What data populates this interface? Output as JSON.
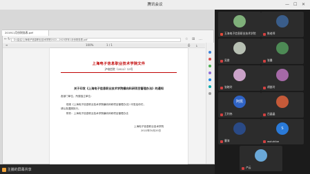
{
  "window": {
    "title": "腾讯会议"
  },
  "browser": {
    "tab_title": "201911月份财务表.pdf",
    "address": "D:/会议/上海电子信息职业技术学院2022—2023学年1月份财务表.pdf"
  },
  "pdf_toolbar": {
    "zoom": "100%",
    "page": "1 / 1"
  },
  "document": {
    "header": "上海电子信息职业技术学院文件",
    "doc_number": "沪电信院〔2022〕13号",
    "title": "关于印发《上海电子信息职业技术学院横向科研项目管理办法》的通知",
    "salutation": "各部门单位，所属独立单位：",
    "para1": "现将《上海电子信息职业技术学院横向科研项目管理办法》印发给你们，",
    "para2": "请认真遵照执行。",
    "attachment": "附件：上海电子信息职业技术学院横向科研项目管理办法",
    "signature": "上海电子信息职业技术学院",
    "date": "2022年10月20日"
  },
  "participants": [
    {
      "name": "玉海电子信息职业技术学院",
      "avatar": "#7fb07a"
    },
    {
      "name": "陈老师",
      "avatar": "#3a5d8a"
    },
    {
      "name": "吴俊",
      "avatar": "#b7c0b3"
    },
    {
      "name": "张曼",
      "avatar": "#4d8a55"
    },
    {
      "name": "张晓玲",
      "avatar": "#caa2c8"
    },
    {
      "name": "胡俊玲",
      "avatar": "#a569a7"
    },
    {
      "name": "王利伟",
      "avatar": "#2f63c5"
    },
    {
      "name": "吕晶晶",
      "avatar": "#c55a39"
    },
    {
      "name": "曹涛",
      "avatar": "#2a4a86"
    },
    {
      "name": "woluhibe",
      "avatar": "#2a7ad8"
    },
    {
      "name": "卢云",
      "avatar": "#6aa8d8"
    }
  ],
  "avatar_text": {
    "p7": "阿凯",
    "p10": "S"
  },
  "footer": {
    "share_label": "主播的屏幕共享"
  }
}
